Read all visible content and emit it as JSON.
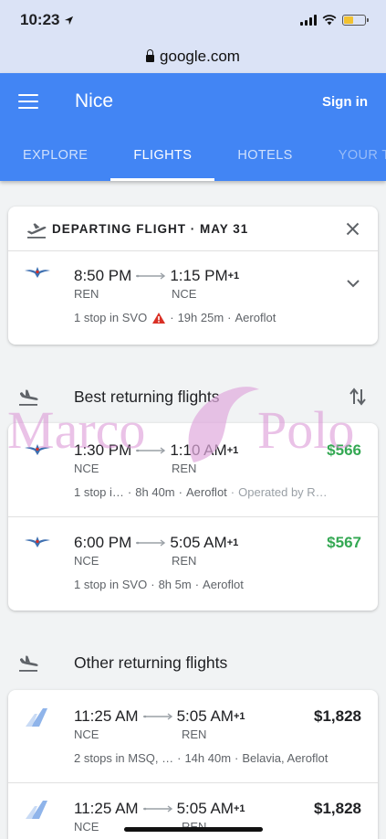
{
  "status_bar": {
    "time": "10:23"
  },
  "browser": {
    "url": "google.com"
  },
  "header": {
    "title": "Nice",
    "sign_in": "Sign in"
  },
  "tabs": [
    {
      "label": "EXPLORE"
    },
    {
      "label": "FLIGHTS"
    },
    {
      "label": "HOTELS"
    },
    {
      "label": "YOUR TRI"
    }
  ],
  "departing": {
    "title": "DEPARTING FLIGHT · MAY 31",
    "flight": {
      "dep_time": "8:50 PM",
      "arr_time": "1:15 PM",
      "day_offset": "+1",
      "from": "REN",
      "to": "NCE",
      "stops": "1 stop in SVO",
      "duration": "19h 25m",
      "airline": "Aeroflot"
    }
  },
  "best_returning": {
    "title": "Best returning flights",
    "flights": [
      {
        "dep_time": "1:30 PM",
        "arr_time": "1:10 AM",
        "day_offset": "+1",
        "from": "NCE",
        "to": "REN",
        "stops": "1 stop i…",
        "duration": "8h 40m",
        "airline": "Aeroflot",
        "operated": "Operated by R…",
        "price": "$566"
      },
      {
        "dep_time": "6:00 PM",
        "arr_time": "5:05 AM",
        "day_offset": "+1",
        "from": "NCE",
        "to": "REN",
        "stops": "1 stop in SVO",
        "duration": "8h 5m",
        "airline": "Aeroflot",
        "price": "$567"
      }
    ]
  },
  "other_returning": {
    "title": "Other returning flights",
    "flights": [
      {
        "dep_time": "11:25 AM",
        "arr_time": "5:05 AM",
        "day_offset": "+1",
        "from": "NCE",
        "to": "REN",
        "stops": "2 stops in MSQ, …",
        "duration": "14h 40m",
        "airline": "Belavia, Aeroflot",
        "price": "$1,828"
      },
      {
        "dep_time": "11:25 AM",
        "arr_time": "5:05 AM",
        "day_offset": "+1",
        "from": "NCE",
        "to": "REN",
        "price": "$1,828"
      }
    ]
  },
  "watermark": {
    "text_left": "Marco",
    "text_right": "Polo"
  },
  "colors": {
    "brand_blue": "#4285f4",
    "price_green": "#34a853",
    "warning_red": "#d93025"
  }
}
